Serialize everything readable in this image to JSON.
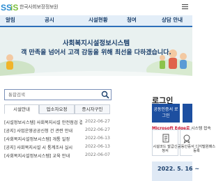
{
  "header": {
    "logo_text": "한국사회보장정보원",
    "logo_mark": "SSiS"
  },
  "gnb": [
    "알림",
    "공시",
    "시설현황",
    "청여",
    "상담 안내"
  ],
  "banner": {
    "title": "사회복지시설정보시스템",
    "subtitle": "객 만족을 넘어서 고객 감동을 위해 최선을 다하겠습니다."
  },
  "search": {
    "placeholder": "통합검색"
  },
  "tabs": [
    "시설안내",
    "업소자오정",
    "증시자구인"
  ],
  "notices": [
    {
      "title": "[시설정보시스템] 사회복지시설 안전점검 결과 시스템 보고 일정 안내",
      "date": "2022-06-27"
    },
    {
      "title": "[공지] 사업운영공공신청 건 관련 안내",
      "date": "2022-06-27"
    },
    {
      "title": "[사회복지시설정보시스템] 개통 일정",
      "date": "2022-06-13"
    },
    {
      "title": "[공지] 사회복지시설 시 통계조사 실시",
      "date": "2022-06-13"
    },
    {
      "title": "[사회복지시설정보시스템] 교육 안내",
      "date": "2022-06-07"
    }
  ],
  "login": {
    "title": "로그인",
    "cert_label": "공동인증서 로그인",
    "edge_brand": "Microsoft Edge로",
    "edge_rest": " 시스템 접속"
  },
  "services": [
    {
      "label": "시설코드 발급신청서"
    },
    {
      "label": "공동인증서 디지털원패스 등록"
    }
  ],
  "bottom": {
    "date": "2022. 5. 16 ~"
  },
  "colors": {
    "nav_bg": "#e3eef8",
    "accent": "#2c6fba",
    "login_blue": "#1d4fa0",
    "banner_bg": "#e9f1f0"
  }
}
